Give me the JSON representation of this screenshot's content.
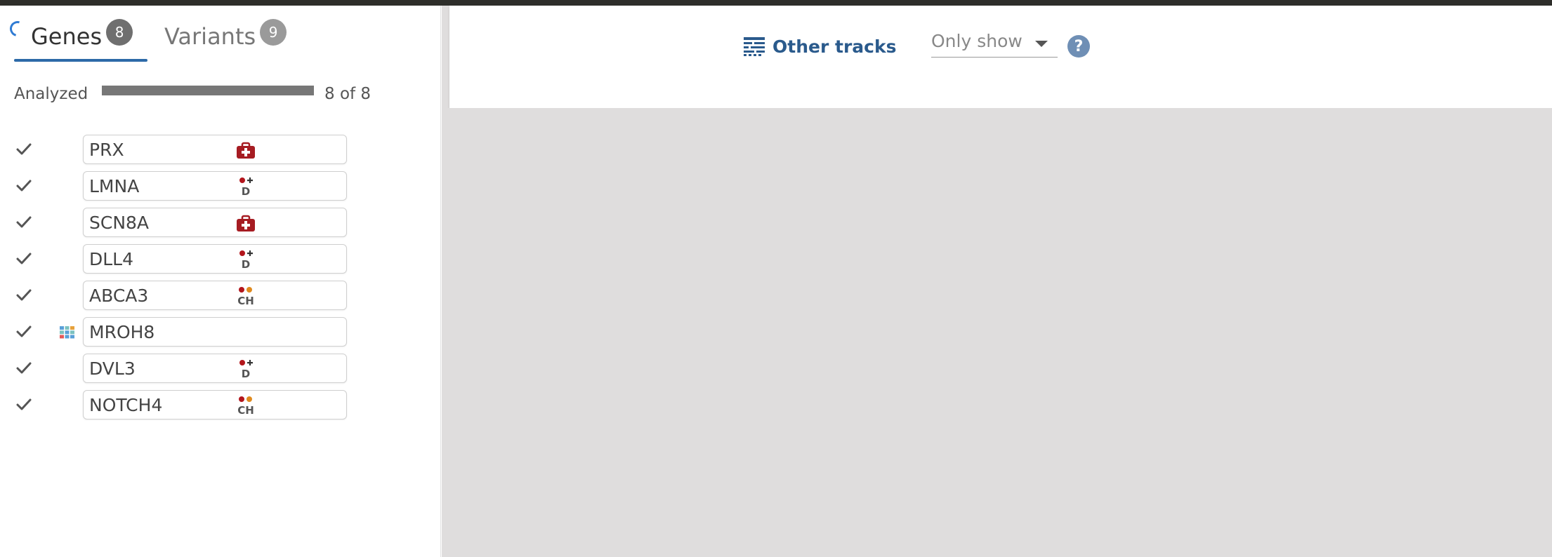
{
  "tabs": {
    "genes": {
      "label": "Genes",
      "count": "8"
    },
    "variants": {
      "label": "Variants",
      "count": "9"
    }
  },
  "analyzed": {
    "label": "Analyzed",
    "count_text": "8 of 8",
    "progress": 1.0
  },
  "genes": [
    {
      "name": "PRX",
      "icon": "medical-kit-icon"
    },
    {
      "name": "LMNA",
      "icon": "de-novo-icon",
      "icon_text": "D"
    },
    {
      "name": "SCN8A",
      "icon": "medical-kit-icon"
    },
    {
      "name": "DLL4",
      "icon": "de-novo-icon",
      "icon_text": "D"
    },
    {
      "name": "ABCA3",
      "icon": "compound-het-icon",
      "icon_text": "CH"
    },
    {
      "name": "MROH8",
      "icon": "tile-grid-icon"
    },
    {
      "name": "DVL3",
      "icon": "de-novo-icon",
      "icon_text": "D"
    },
    {
      "name": "NOTCH4",
      "icon": "compound-het-icon",
      "icon_text": "CH"
    }
  ],
  "toolbar": {
    "other_tracks_label": "Other tracks",
    "only_show_label": "Only show",
    "help_label": "?"
  },
  "colors": {
    "accent": "#2d6aa8",
    "medical_red": "#a61c22",
    "dot_red": "#b3161c",
    "dot_orange": "#e08a1e",
    "panel_gray": "#dfdddd"
  }
}
